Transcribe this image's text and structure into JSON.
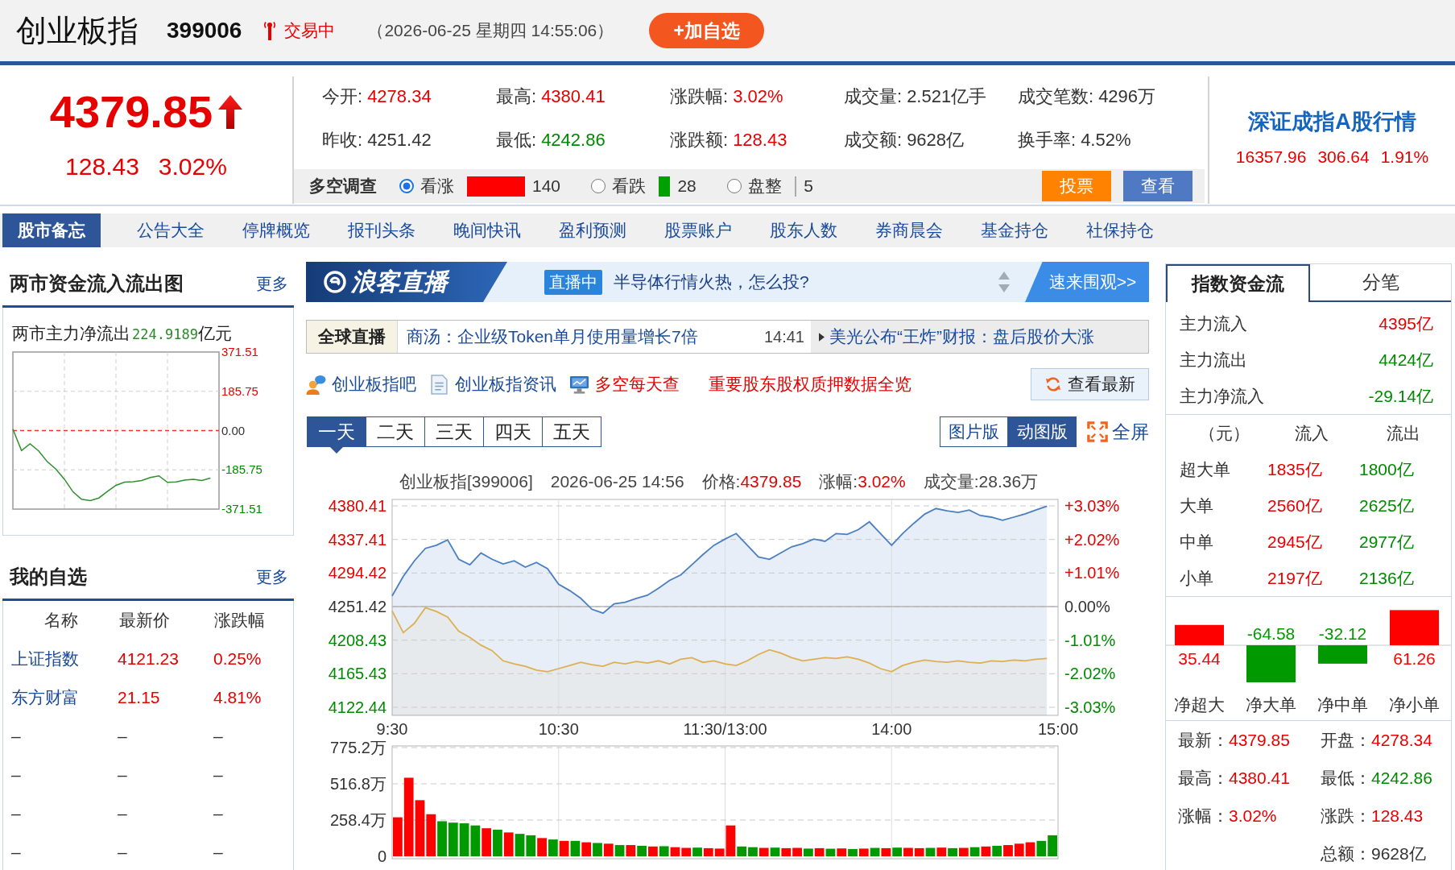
{
  "header": {
    "title": "创业板指",
    "code": "399006",
    "status": "交易中",
    "datetime": "（2026-06-25 星期四 14:55:06）",
    "add_button": "+加自选"
  },
  "quote": {
    "price": "4379.85",
    "change": "128.43",
    "change_pct": "3.02%",
    "color": "#e60000",
    "stats": [
      {
        "label": "今开:",
        "value": "4278.34",
        "color": "#e60000"
      },
      {
        "label": "最高:",
        "value": "4380.41",
        "color": "#e60000"
      },
      {
        "label": "涨跌幅:",
        "value": "3.02%",
        "color": "#e60000"
      },
      {
        "label": "成交量:",
        "value": "2.521亿手",
        "color": "#333333"
      },
      {
        "label": "成交笔数:",
        "value": "4296万",
        "color": "#333333"
      },
      {
        "label": "昨收:",
        "value": "4251.42",
        "color": "#333333"
      },
      {
        "label": "最低:",
        "value": "4242.86",
        "color": "#008a00"
      },
      {
        "label": "涨跌额:",
        "value": "128.43",
        "color": "#e60000"
      },
      {
        "label": "成交额:",
        "value": "9628亿",
        "color": "#333333"
      },
      {
        "label": "换手率:",
        "value": "4.52%",
        "color": "#333333"
      }
    ]
  },
  "survey": {
    "title": "多空调查",
    "options": [
      {
        "label": "看涨",
        "selected": true,
        "color": "#ff0000",
        "count": "140"
      },
      {
        "label": "看跌",
        "selected": false,
        "color": "#00a000",
        "count": "28"
      },
      {
        "label": "盘整",
        "selected": false,
        "color": "#aaaaaa",
        "count": "5"
      }
    ],
    "buttons": [
      {
        "label": "投票",
        "kind": "accent"
      },
      {
        "label": "查看",
        "kind": "primary"
      }
    ]
  },
  "market_panel": {
    "title": "深证成指A股行情",
    "price": "16357.96",
    "change": "306.64",
    "change_pct": "1.91%",
    "color": "#e60000"
  },
  "nav": [
    {
      "label": "股市备忘",
      "selected": true
    },
    {
      "label": "公告大全",
      "selected": false
    },
    {
      "label": "停牌概览",
      "selected": false
    },
    {
      "label": "报刊头条",
      "selected": false
    },
    {
      "label": "晚间快讯",
      "selected": false
    },
    {
      "label": "盈利预测",
      "selected": false
    },
    {
      "label": "股票账户",
      "selected": false
    },
    {
      "label": "股东人数",
      "selected": false
    },
    {
      "label": "券商晨会",
      "selected": false
    },
    {
      "label": "基金持仓",
      "selected": false
    },
    {
      "label": "社保持仓",
      "selected": false
    }
  ],
  "fund_flow": {
    "title": "两市资金流入流出图",
    "more": "更多",
    "caption": "两市主力净流出",
    "caption_value": "224.9189",
    "caption_unit": "亿元",
    "chart_data": {
      "type": "line",
      "categories": [
        null,
        null,
        null,
        null,
        null,
        null,
        null,
        null,
        null,
        null,
        null,
        null,
        null,
        null,
        null,
        null,
        null,
        null,
        null,
        null,
        null,
        null,
        null,
        null,
        null
      ],
      "series": [
        {
          "color": "#2f8f2f",
          "values": [
            7,
            -95,
            -63,
            -96,
            -147,
            -182,
            -230,
            -290,
            -325,
            -331,
            -319,
            -288,
            -259,
            -244,
            -242,
            -236,
            -222,
            -214,
            -245,
            -243,
            -234,
            -231,
            -236,
            -225,
            null
          ]
        }
      ],
      "ylim": [
        -371.51,
        371.51
      ],
      "yticks": [
        371.51,
        185.75,
        {
          "value": 0,
          "label": "0.00"
        },
        -185.75,
        -371.51
      ],
      "grid": true,
      "ref_lines": [
        {
          "axis": "y",
          "value": 0,
          "color": "#ff2a2a"
        }
      ]
    }
  },
  "watchlist": {
    "title": "我的自选",
    "more": "更多",
    "columns": [
      "名称",
      "最新价",
      "涨跌幅"
    ],
    "rows": [
      {
        "kind": "stock",
        "name": "上证指数",
        "price": "4121.23",
        "change": "0.25%",
        "color": "#e60000"
      },
      {
        "kind": "stock",
        "name": "东方财富",
        "price": "21.15",
        "change": "4.81%",
        "color": "#e60000"
      },
      {
        "kind": "empty",
        "name": "–",
        "price": "–",
        "change": "–",
        "color": "#333333"
      },
      {
        "kind": "empty",
        "name": "–",
        "price": "–",
        "change": "–",
        "color": "#333333"
      },
      {
        "kind": "empty",
        "name": "–",
        "price": "–",
        "change": "–",
        "color": "#333333"
      },
      {
        "kind": "empty",
        "name": "–",
        "price": "–",
        "change": "–",
        "color": "#333333"
      }
    ]
  },
  "live_banner": {
    "brand": "浪客直播",
    "badge": "直播中",
    "headline": "半导体行情火热，怎么投?",
    "cta": "速来围观>>"
  },
  "news_ticker": {
    "label": "全球直播",
    "headline": "商汤：企业级Token单月使用量增长7倍",
    "time": "14:41",
    "next_headline": "美光公布“王炸”财报：盘后股价大涨"
  },
  "quick_links": [
    {
      "label": "创业板指吧",
      "kind": "forum"
    },
    {
      "label": "创业板指资讯",
      "kind": "news"
    },
    {
      "label": "多空每天查",
      "kind": "survey"
    },
    {
      "label": "重要股东股权质押数据全览",
      "kind": "promo"
    }
  ],
  "refresh_button": "查看最新",
  "period_tabs": [
    {
      "label": "一天",
      "selected": true
    },
    {
      "label": "二天",
      "selected": false
    },
    {
      "label": "三天",
      "selected": false
    },
    {
      "label": "四天",
      "selected": false
    },
    {
      "label": "五天",
      "selected": false
    }
  ],
  "view_tabs": [
    {
      "label": "图片版",
      "selected": false
    },
    {
      "label": "动图版",
      "selected": true
    }
  ],
  "fullscreen_button": "全屏",
  "chart_info": [
    {
      "value": "创业板指[399006]",
      "color": "#444444"
    },
    {
      "value": "2026-06-25 14:56",
      "color": "#444444"
    },
    {
      "label": "价格:",
      "value": "4379.85",
      "color": "#e60000"
    },
    {
      "label": "涨幅:",
      "value": "3.02%",
      "color": "#e60000"
    },
    {
      "label": "成交量:",
      "value": "28.36万",
      "color": "#444444"
    }
  ],
  "price_chart": {
    "right_axis": [
      "+3.03%",
      "+2.02%",
      "+1.01%",
      "0.00%",
      "-1.01%",
      "-2.02%",
      "-3.03%"
    ],
    "chart_data": {
      "type": "area",
      "categories": [
        "9:30",
        null,
        null,
        null,
        null,
        null,
        null,
        null,
        null,
        null,
        null,
        null,
        null,
        null,
        null,
        "10:30",
        null,
        null,
        null,
        null,
        null,
        null,
        null,
        null,
        null,
        null,
        null,
        null,
        null,
        null,
        "11:30/13:00",
        null,
        null,
        null,
        null,
        null,
        null,
        null,
        null,
        null,
        null,
        null,
        null,
        null,
        null,
        "14:00",
        null,
        null,
        null,
        null,
        null,
        null,
        null,
        null,
        null,
        null,
        null,
        null,
        null,
        null,
        "15:00"
      ],
      "series": [
        {
          "color": "#4a7fc0",
          "values": [
            4265,
            4290,
            4310,
            4326,
            4330,
            4337,
            4312,
            4305,
            4320,
            4312,
            4306,
            4310,
            4302,
            4308,
            4300,
            4280,
            4272,
            4262,
            4248,
            4243,
            4255,
            4257,
            4262,
            4266,
            4275,
            4285,
            4292,
            4305,
            4318,
            4330,
            4338,
            4345,
            4330,
            4315,
            4312,
            4320,
            4328,
            4332,
            4338,
            4335,
            4345,
            4344,
            4350,
            4360,
            4345,
            4330,
            4345,
            4358,
            4370,
            4377,
            4374,
            4372,
            4375,
            4368,
            4366,
            4362,
            4366,
            4370,
            4375,
            4380,
            null
          ]
        },
        {
          "color": "#dcb052",
          "values": [
            4246,
            4218,
            4230,
            4250,
            4245,
            4238,
            4220,
            4212,
            4202,
            4195,
            4182,
            4178,
            4175,
            4170,
            4168,
            4172,
            4176,
            4180,
            4177,
            4175,
            4180,
            4178,
            4181,
            4179,
            4182,
            4178,
            4184,
            4186,
            4180,
            4182,
            4178,
            4176,
            4182,
            4190,
            4196,
            4192,
            4186,
            4182,
            4184,
            4186,
            4185,
            4187,
            4184,
            4179,
            4172,
            4168,
            4176,
            4180,
            4183,
            4181,
            4180,
            4182,
            4180,
            4179,
            4182,
            4181,
            4183,
            4182,
            4184,
            4185,
            null
          ]
        }
      ],
      "ylim": [
        4122.44,
        4380.41
      ],
      "yticks": [
        4380.41,
        4337.41,
        4294.42,
        4251.42,
        4208.43,
        4165.43,
        4122.44
      ],
      "grid": true,
      "ref_lines": [
        {
          "axis": "y",
          "value": 4251.42,
          "color": "#b5b5b5"
        }
      ]
    }
  },
  "volume_chart": {
    "chart_data": {
      "type": "bar",
      "categories": [
        null,
        null,
        null,
        null,
        null,
        null,
        null,
        null,
        null,
        null,
        null,
        null,
        null,
        null,
        null,
        null,
        null,
        null,
        null,
        null,
        null,
        null,
        null,
        null,
        null,
        null,
        null,
        null,
        null,
        null,
        null,
        null,
        null,
        null,
        null,
        null,
        null,
        null,
        null,
        null,
        null,
        null,
        null,
        null,
        null,
        null,
        null,
        null,
        null,
        null,
        null,
        null,
        null,
        null,
        null,
        null,
        null,
        null,
        null,
        null
      ],
      "series": [
        {
          "color": "#ff0000",
          "values": [
            278,
            560,
            400,
            300,
            null,
            null,
            null,
            null,
            200,
            null,
            170,
            null,
            null,
            130,
            null,
            110,
            null,
            100,
            null,
            90,
            null,
            80,
            null,
            70,
            null,
            65,
            60,
            null,
            58,
            55,
            220,
            null,
            null,
            60,
            null,
            58,
            60,
            null,
            58,
            null,
            56,
            null,
            55,
            null,
            58,
            null,
            60,
            58,
            null,
            62,
            null,
            60,
            null,
            70,
            null,
            80,
            90,
            100,
            null,
            null
          ]
        },
        {
          "color": "#009900",
          "values": [
            null,
            null,
            null,
            null,
            250,
            240,
            235,
            220,
            null,
            190,
            null,
            160,
            150,
            null,
            120,
            null,
            110,
            null,
            95,
            null,
            80,
            null,
            75,
            null,
            72,
            null,
            null,
            62,
            null,
            null,
            null,
            70,
            65,
            null,
            62,
            null,
            null,
            55,
            null,
            54,
            null,
            52,
            null,
            60,
            null,
            62,
            null,
            null,
            60,
            null,
            58,
            null,
            65,
            null,
            75,
            null,
            null,
            null,
            110,
            150
          ]
        }
      ],
      "ylim": [
        0,
        775.2
      ],
      "yticks": [
        {
          "value": 775.2,
          "label": "775.2万"
        },
        {
          "value": 516.8,
          "label": "516.8万"
        },
        {
          "value": 258.4,
          "label": "258.4万"
        },
        0
      ],
      "grid": true
    }
  },
  "flow_tabs": [
    {
      "label": "指数资金流",
      "selected": true
    },
    {
      "label": "分笔",
      "selected": false
    }
  ],
  "main_flow": [
    {
      "label": "主力流入",
      "value": "4395亿",
      "color": "#e60000"
    },
    {
      "label": "主力流出",
      "value": "4424亿",
      "color": "#008a00"
    },
    {
      "label": "主力净流入",
      "value": "-29.14亿",
      "color": "#008a00"
    }
  ],
  "order_table": {
    "columns": [
      "（元）",
      "流入",
      "流出"
    ],
    "rows": [
      {
        "label": "超大单",
        "inflow": "1835亿",
        "outflow": "1800亿"
      },
      {
        "label": "大单",
        "inflow": "2560亿",
        "outflow": "2625亿"
      },
      {
        "label": "中单",
        "inflow": "2945亿",
        "outflow": "2977亿"
      },
      {
        "label": "小单",
        "inflow": "2197亿",
        "outflow": "2136亿"
      }
    ]
  },
  "net_flow": {
    "chart_data": {
      "type": "bar",
      "categories": [
        "净超大",
        "净大单",
        "净中单",
        "净小单"
      ],
      "series": [
        {
          "color": "#ff0000",
          "values": [
            35.44,
            null,
            null,
            61.26
          ]
        },
        {
          "color": "#009900",
          "values": [
            null,
            -64.58,
            -32.12,
            null
          ]
        }
      ],
      "data_labels": true
    }
  },
  "summary": [
    {
      "left": {
        "label": "最新：",
        "value": "4379.85",
        "color": "#e60000"
      },
      "right": {
        "label": "开盘：",
        "value": "4278.34",
        "color": "#e60000"
      }
    },
    {
      "left": {
        "label": "最高：",
        "value": "4380.41",
        "color": "#e60000"
      },
      "right": {
        "label": "最低：",
        "value": "4242.86",
        "color": "#008a00"
      }
    },
    {
      "left": {
        "label": "涨幅：",
        "value": "3.02%",
        "color": "#e60000"
      },
      "right": {
        "label": "涨跌：",
        "value": "128.43",
        "color": "#e60000"
      }
    },
    {
      "right": {
        "label": "总额：",
        "value": "9628亿",
        "color": "#333333"
      }
    }
  ]
}
